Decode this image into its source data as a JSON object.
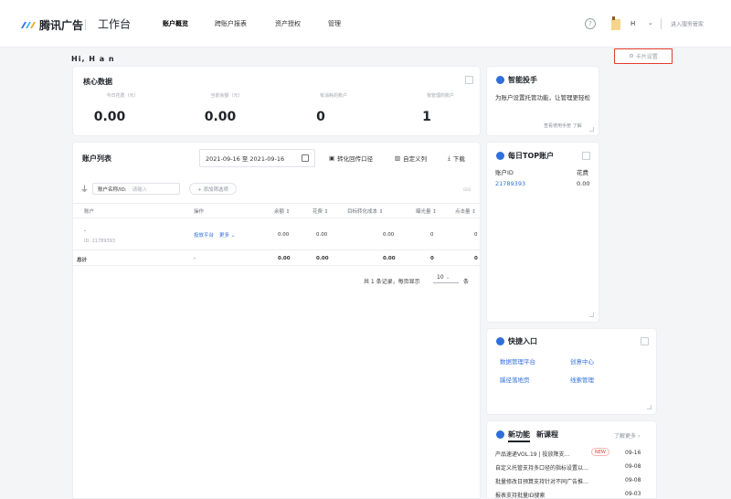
{
  "header": {
    "brand": "腾讯广告",
    "workbench": "工作台",
    "tabs": [
      {
        "label": "账户概览",
        "active": true
      },
      {
        "label": "跨账户报表",
        "active": false
      },
      {
        "label": "资产授权",
        "active": false
      },
      {
        "label": "管理",
        "active": false
      }
    ],
    "user": "H",
    "enter_link": "进入服务管家"
  },
  "greeting": "Hi, H a n",
  "card_settings_label": "卡片设置",
  "core": {
    "title": "核心数据",
    "metrics": [
      {
        "label": "今日花费（元）",
        "value": "0.00"
      },
      {
        "label": "当前余额（元）",
        "value": "0.00"
      },
      {
        "label": "有消耗的账户",
        "value": "0"
      },
      {
        "label": "我管理的账户",
        "value": "1"
      }
    ]
  },
  "accounts": {
    "title": "账户列表",
    "date_range": "2021-09-16 至 2021-09-16",
    "tools": [
      "转化回传口径",
      "自定义列",
      "下载"
    ],
    "filter_label": "账户名称/ID:",
    "filter_placeholder": "请输入",
    "add_filter": "+ 添加筛选项",
    "columns": [
      "账户",
      "操作",
      "余额 ↕",
      "花费 ↕",
      "目标转化成本 ↕",
      "曝光量 ↕",
      "点击量 ↕"
    ],
    "rows": [
      {
        "name": "-",
        "id": "ID: 21789393",
        "action": "投放平台",
        "more": "更多",
        "balance": "0.00",
        "cost": "0.00",
        "cpa": "0.00",
        "impressions": "0",
        "clicks": "0"
      }
    ],
    "total": {
      "label": "总计",
      "action": "-",
      "balance": "0.00",
      "cost": "0.00",
      "cpa": "0.00",
      "impressions": "0",
      "clicks": "0"
    },
    "pager": {
      "summary": "共 1 条记录，每页显示",
      "page_size": "10",
      "unit": "条"
    }
  },
  "assistant": {
    "title": "智能投手",
    "text": "为账户设置托管功能，让管理更轻松",
    "cut_text": "查看使用手册 了解"
  },
  "top_accounts": {
    "title": "每日TOP账户",
    "columns": [
      "账户ID",
      "花费"
    ],
    "rows": [
      {
        "id": "21789393",
        "cost": "0.00"
      }
    ]
  },
  "quick": {
    "title": "快捷入口",
    "links": [
      "数据管理平台",
      "创意中心",
      "蹊径落地页",
      "线索管理"
    ]
  },
  "news": {
    "tab_feature": "新功能",
    "tab_course": "新课程",
    "more": "了解更多",
    "badge": "NEW",
    "items": [
      {
        "title": "产品速递VOL.19 | 投放降支…",
        "date": "09-16"
      },
      {
        "title": "自定义托管支持多口径的指标设置以…",
        "date": "09-08"
      },
      {
        "title": "批量修改日预算支持针对不同广告推…",
        "date": "09-08"
      },
      {
        "title": "报表支持批量ID搜索",
        "date": "09-03"
      }
    ]
  }
}
